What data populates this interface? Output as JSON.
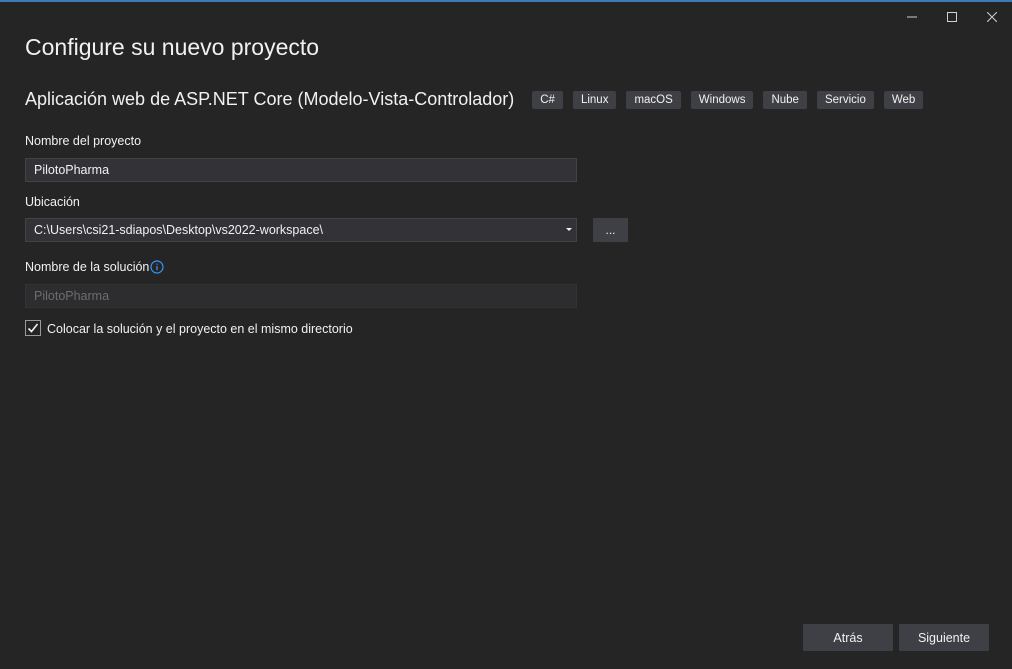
{
  "window": {
    "controls": [
      {
        "name": "minimize-icon"
      },
      {
        "name": "maximize-icon"
      },
      {
        "name": "close-icon"
      }
    ]
  },
  "page": {
    "title": "Configure su nuevo proyecto"
  },
  "template": {
    "name": "Aplicación web de ASP.NET Core (Modelo-Vista-Controlador)",
    "tags": [
      "C#",
      "Linux",
      "macOS",
      "Windows",
      "Nube",
      "Servicio",
      "Web"
    ]
  },
  "form": {
    "project_name_label": "Nombre del proyecto",
    "project_name_value": "PilotoPharma",
    "location_label": "Ubicación",
    "location_value": "C:\\Users\\csi21-sdiapos\\Desktop\\vs2022-workspace\\",
    "browse_label": "...",
    "solution_name_label": "Nombre de la solución",
    "solution_name_value": "PilotoPharma",
    "same_directory_label": "Colocar la solución y el proyecto en el mismo directorio",
    "same_directory_checked": true
  },
  "footer": {
    "back_label": "Atrás",
    "next_label": "Siguiente"
  },
  "colors": {
    "background": "#252526",
    "accent_top_line": "#3d7ab8",
    "info_icon": "#3794ff"
  }
}
